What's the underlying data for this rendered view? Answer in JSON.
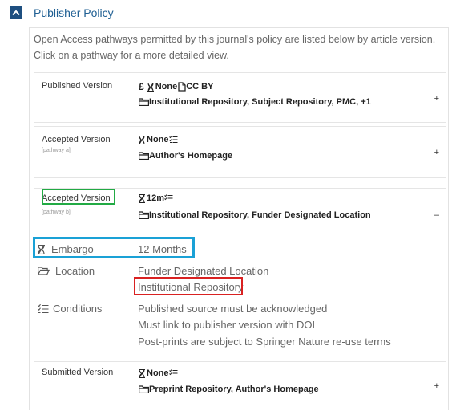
{
  "header": {
    "title": "Publisher Policy"
  },
  "intro": "Open Access pathways permitted by this journal's policy are listed below by article version. Click on a pathway for a more detailed view.",
  "pathways": [
    {
      "version": "Published Version",
      "pathway_label": "",
      "fee": "£",
      "embargo": "None",
      "license": "CC BY",
      "locations": "Institutional Repository, Subject Repository, PMC, +1",
      "toggle": "+"
    },
    {
      "version": "Accepted Version",
      "pathway_label": "[pathway a]",
      "embargo": "None",
      "locations": "Author's Homepage",
      "toggle": "+"
    },
    {
      "version": "Accepted Version",
      "pathway_label": "[pathway b]",
      "embargo": "12m",
      "locations": "Institutional Repository, Funder Designated Location",
      "toggle": "–",
      "details": {
        "embargo_label": "Embargo",
        "embargo_value": "12 Months",
        "location_label": "Location",
        "locations": [
          "Funder Designated Location",
          "Institutional Repository"
        ],
        "conditions_label": "Conditions",
        "conditions": [
          "Published source must be acknowledged",
          "Must link to publisher version with DOI",
          "Post-prints are subject to Springer Nature re-use terms"
        ]
      }
    },
    {
      "version": "Submitted Version",
      "pathway_label": "",
      "embargo": "None",
      "locations": "Preprint Repository, Author's Homepage",
      "toggle": "+"
    }
  ],
  "colors": {
    "header_title": "#1f5f93",
    "toggle_bg": "#1e4f80",
    "highlight_green": "#22aa44",
    "highlight_blue": "#1aa1d6",
    "highlight_red": "#d92121"
  }
}
